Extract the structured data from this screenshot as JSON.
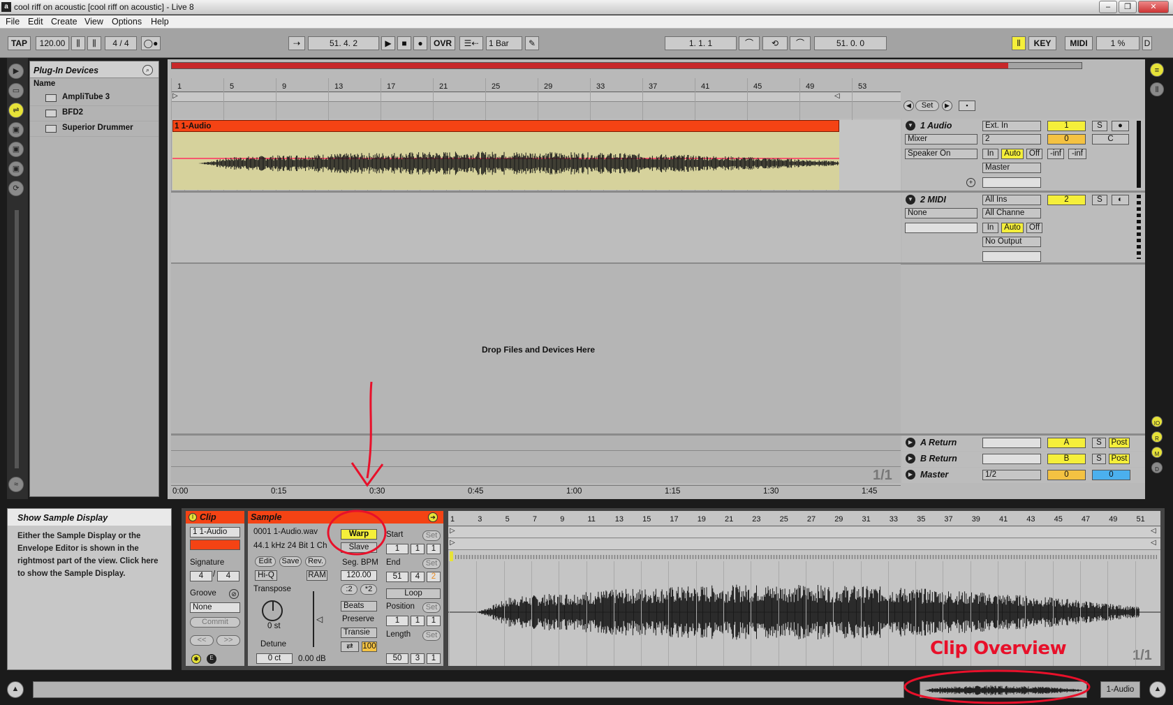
{
  "window": {
    "title": "cool riff on acoustic  [cool riff on acoustic] - Live 8"
  },
  "menu": [
    "File",
    "Edit",
    "Create",
    "View",
    "Options",
    "Help"
  ],
  "control_bar": {
    "tap": "TAP",
    "tempo": "120.00",
    "signature": "4 / 4",
    "position": "51.   4.   2",
    "ovr": "OVR",
    "quantize": "1 Bar",
    "loop_start": "1.   1.   1",
    "loop_length": "51.   0.   0",
    "key": "KEY",
    "midi": "MIDI",
    "cpu": "1 %"
  },
  "browser": {
    "title": "Plug-In Devices",
    "column": "Name",
    "items": [
      "AmpliTube 3",
      "BFD2",
      "Superior Drummer"
    ]
  },
  "arrangement": {
    "bar_numbers": [
      "1",
      "5",
      "9",
      "13",
      "17",
      "21",
      "25",
      "29",
      "33",
      "37",
      "41",
      "45",
      "49",
      "53"
    ],
    "time_labels": [
      "0:00",
      "0:15",
      "0:30",
      "0:45",
      "1:00",
      "1:15",
      "1:30",
      "1:45"
    ],
    "drop_text": "Drop Files and Devices Here",
    "zoom_label": "1/1",
    "set_label": "Set",
    "clip_name": "1 1-Audio"
  },
  "tracks": {
    "audio": {
      "name": "1 Audio",
      "input": "Ext. In",
      "input_ch": "2",
      "mixer": "Mixer",
      "speaker": "Speaker On",
      "in": "In",
      "auto": "Auto",
      "off": "Off",
      "output": "Master",
      "num": "1",
      "solo": "S",
      "vol": "0",
      "pan": "C",
      "inf1": "-inf",
      "inf2": "-inf"
    },
    "midi": {
      "name": "2 MIDI",
      "input": "All Ins",
      "channel": "All Channe",
      "device": "None",
      "in": "In",
      "auto": "Auto",
      "off": "Off",
      "output": "No Output",
      "num": "2",
      "solo": "S"
    },
    "return_a": {
      "name": "A Return",
      "letter": "A",
      "solo": "S",
      "post": "Post"
    },
    "return_b": {
      "name": "B Return",
      "letter": "B",
      "solo": "S",
      "post": "Post"
    },
    "master": {
      "name": "Master",
      "cue": "1/2",
      "vol": "0",
      "pan": "0"
    }
  },
  "info_view": {
    "title": "Show Sample Display",
    "body": "Either the Sample Display or the Envelope Editor is shown in the rightmost part of the view. Click here to show the Sample Display."
  },
  "clip_view": {
    "header": "Clip",
    "name": "1 1-Audio",
    "signature_label": "Signature",
    "sig_num": "4",
    "sig_den": "4",
    "groove_label": "Groove",
    "groove": "None",
    "commit": "Commit",
    "nav_prev": "<<",
    "nav_next": ">>"
  },
  "sample_view": {
    "header": "Sample",
    "file": "0001 1-Audio.wav",
    "format": "44.1 kHz 24 Bit 1 Ch",
    "edit": "Edit",
    "save": "Save",
    "rev": "Rev.",
    "hiq": "Hi-Q",
    "ram": "RAM",
    "transpose_label": "Transpose",
    "transpose": "0 st",
    "detune_label": "Detune",
    "detune": "0 ct",
    "gain": "0.00 dB",
    "warp": "Warp",
    "slave": "Slave",
    "seg_bpm_label": "Seg. BPM",
    "seg_bpm": "120.00",
    "half": ":2",
    "double": "*2",
    "mode": "Beats",
    "preserve_label": "Preserve",
    "preserve": "Transie",
    "loop_pct": "100",
    "start_label": "Start",
    "start": [
      "1",
      "1",
      "1"
    ],
    "end_label": "End",
    "end": [
      "51",
      "4",
      "2"
    ],
    "loop": "Loop",
    "position_label": "Position",
    "position": [
      "1",
      "1",
      "1"
    ],
    "length_label": "Length",
    "length": [
      "50",
      "3",
      "1"
    ],
    "set": "Set"
  },
  "sample_display": {
    "bar_numbers": [
      "1",
      "3",
      "5",
      "7",
      "9",
      "11",
      "13",
      "15",
      "17",
      "19",
      "21",
      "23",
      "25",
      "27",
      "29",
      "31",
      "33",
      "35",
      "37",
      "39",
      "41",
      "43",
      "45",
      "47",
      "49",
      "51"
    ],
    "zoom_label": "1/1"
  },
  "annotations": {
    "clip_overview": "Clip Overview"
  },
  "bottom": {
    "track_name": "1-Audio"
  }
}
